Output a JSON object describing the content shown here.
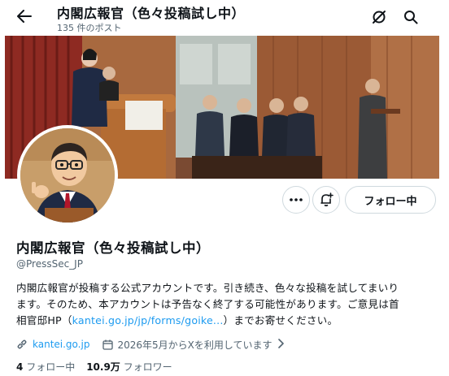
{
  "header": {
    "title": "内閣広報官（色々投稿試し中）",
    "post_count": "135 件のポスト",
    "back_icon": "arrow-left-icon",
    "grok_icon": "grok-icon",
    "search_icon": "search-icon"
  },
  "profile": {
    "display_name": "内閣広報官（色々投稿試し中）",
    "handle": "@PressSec_JP",
    "bio_line1": "内閣広報官が投稿する公式アカウントです。引き続き、色々な投稿を試してまいり",
    "bio_line2": "ます。そのため、本アカウントは予告なく終了する可能性があります。ご意見は首",
    "bio_line3_prefix": "相官邸HP（",
    "bio_link": "kantei.go.jp/jp/forms/goike...",
    "bio_line3_suffix": "）までお寄せください。",
    "website": "kantei.go.jp",
    "joined": "2026年5月からXを利用しています",
    "following_count": "4",
    "following_label": "フォロー中",
    "followers_count": "10.9万",
    "followers_label": "フォロワー"
  },
  "actions": {
    "more_icon": "more-horizontal-icon",
    "notify_icon": "bell-plus-icon",
    "follow_label": "フォロー中"
  },
  "colors": {
    "accent": "#1d9bf0",
    "text_primary": "#0f1419",
    "text_secondary": "#536471",
    "border": "#cfd9de"
  }
}
